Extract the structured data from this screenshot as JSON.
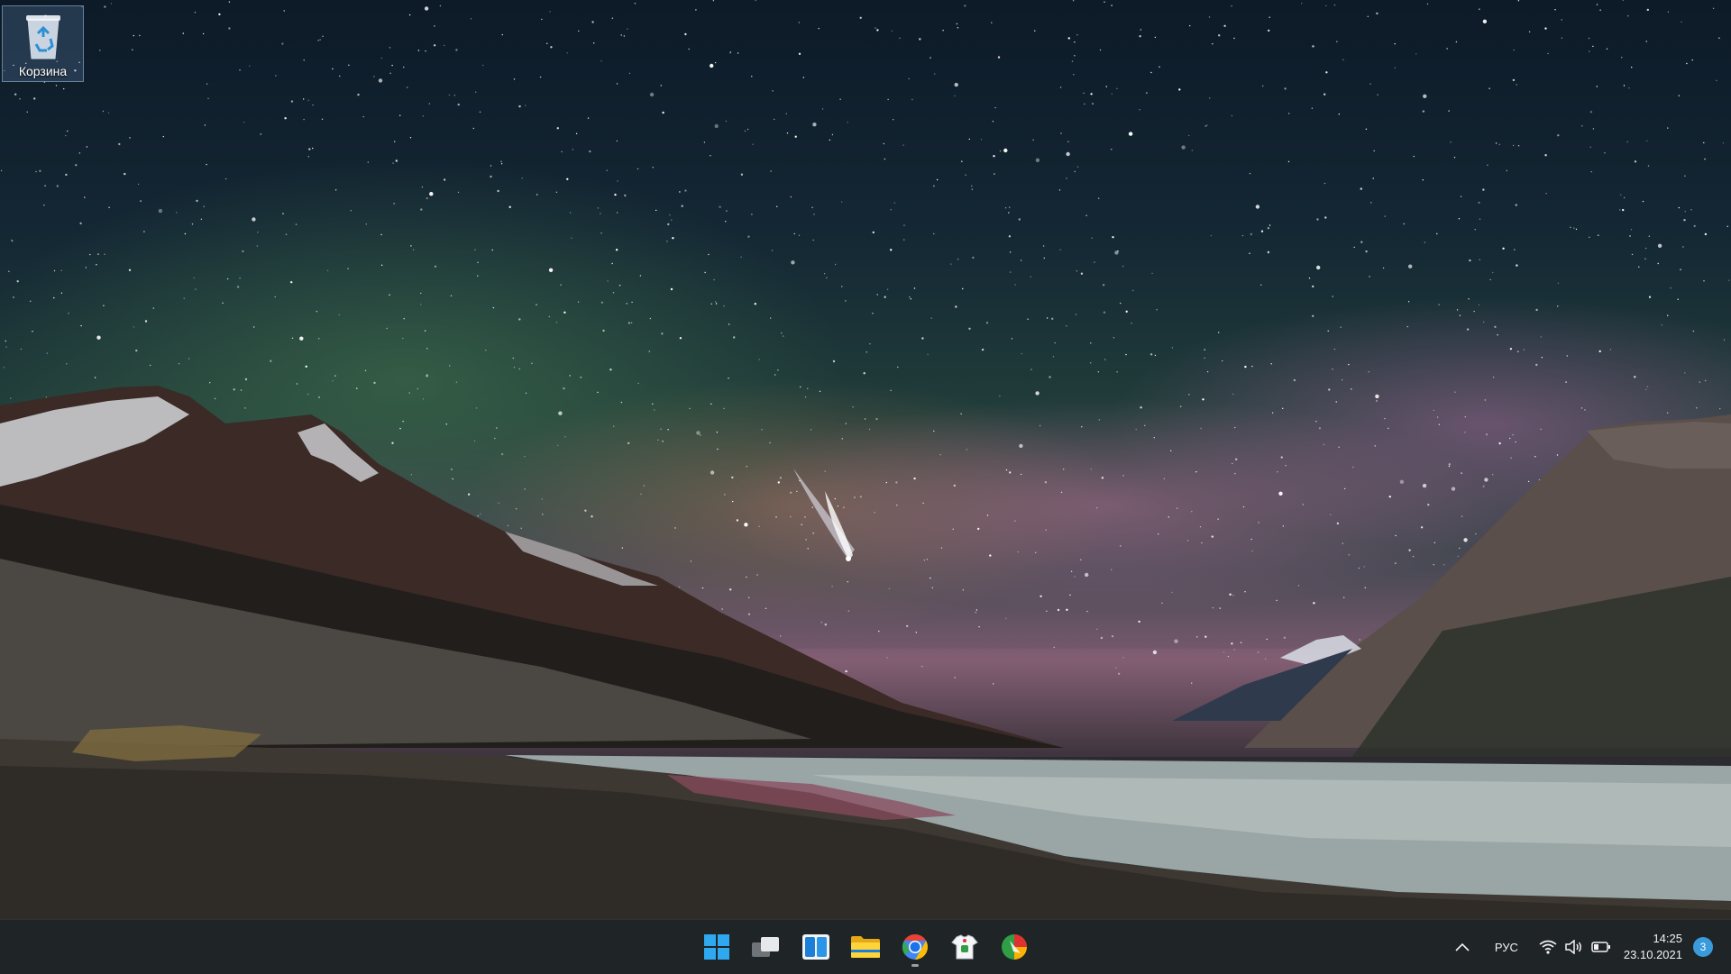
{
  "desktop": {
    "recycle_bin_label": "Корзина"
  },
  "taskbar": {
    "apps": [
      {
        "name": "start",
        "icon": "windows-logo-icon"
      },
      {
        "name": "task-view",
        "icon": "task-view-icon"
      },
      {
        "name": "widgets",
        "icon": "widgets-icon"
      },
      {
        "name": "file-explorer",
        "icon": "folder-icon"
      },
      {
        "name": "chrome",
        "icon": "chrome-icon",
        "active": true
      },
      {
        "name": "pinned-app",
        "icon": "tshirt-app-icon"
      },
      {
        "name": "pinned-app-2",
        "icon": "colorful-circle-app-icon"
      }
    ],
    "tray": {
      "language": "РУС",
      "time": "14:25",
      "date": "23.10.2021",
      "notification_count": "3"
    }
  },
  "colors": {
    "taskbar_bg": "#1f2427",
    "accent": "#3a9bdc"
  }
}
